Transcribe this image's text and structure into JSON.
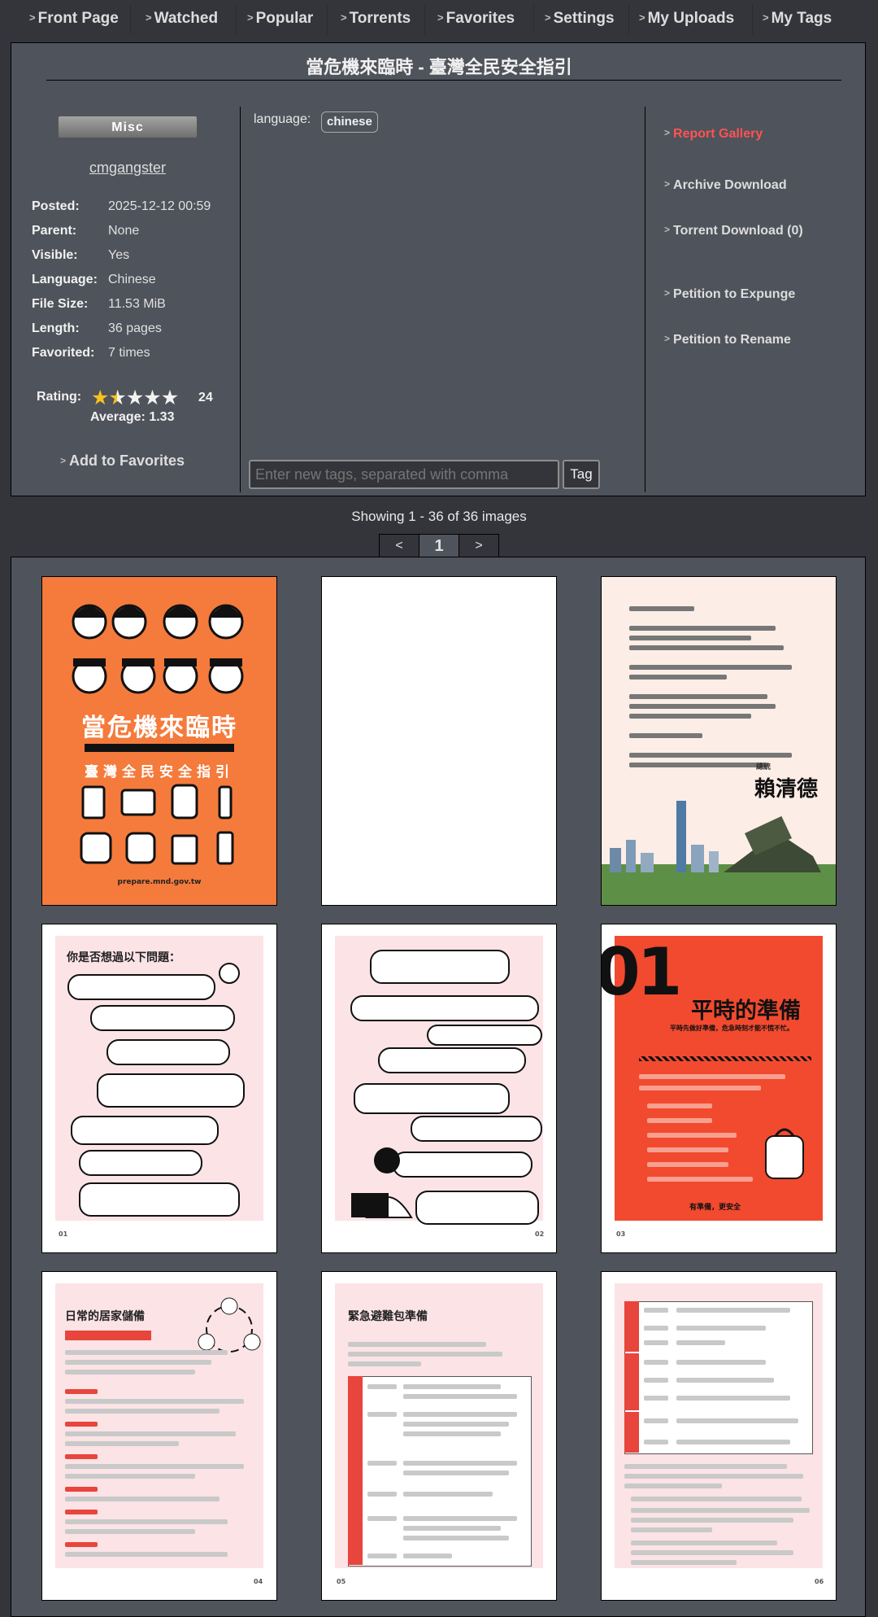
{
  "nav": [
    {
      "label": "Front Page"
    },
    {
      "label": "Watched"
    },
    {
      "label": "Popular"
    },
    {
      "label": "Torrents"
    },
    {
      "label": "Favorites"
    },
    {
      "label": "Settings"
    },
    {
      "label": "My Uploads"
    },
    {
      "label": "My Tags"
    }
  ],
  "gallery": {
    "title": "當危機來臨時 - 臺灣全民安全指引",
    "category": "Misc",
    "uploader": "cmgangster",
    "meta": [
      {
        "key": "Posted:",
        "value": "2025-12-12 00:59"
      },
      {
        "key": "Parent:",
        "value": "None"
      },
      {
        "key": "Visible:",
        "value": "Yes"
      },
      {
        "key": "Language:",
        "value": "Chinese"
      },
      {
        "key": "File Size:",
        "value": "11.53 MiB"
      },
      {
        "key": "Length:",
        "value": "36 pages"
      },
      {
        "key": "Favorited:",
        "value": "7 times"
      }
    ],
    "rating": {
      "label": "Rating:",
      "count": "24",
      "average": "Average: 1.33",
      "stars_value": 1.5,
      "stars_max": 5
    },
    "add_favorites": "Add to Favorites",
    "tags": {
      "namespace": "language:",
      "items": [
        "chinese"
      ]
    },
    "tag_input_placeholder": "Enter new tags, separated with comma",
    "tag_button": "Tag",
    "side_links": [
      "Report Gallery",
      "Archive Download",
      "Torrent Download (0)",
      "Petition to Expunge",
      "Petition to Rename"
    ],
    "accent_color": "#ff5252",
    "star_color": "#f6c21d"
  },
  "pagination": {
    "showing": "Showing 1 - 36 of 36 images",
    "prev": "<",
    "current": "1",
    "next": ">"
  },
  "thumbnails": {
    "cover": {
      "title": "當危機來臨時",
      "subtitle": "臺灣全民安全指引",
      "url": "prepare.mnd.gov.tw",
      "background": "#f47b3c"
    },
    "page3": {
      "signature": "賴清德",
      "label": "總統"
    },
    "page4": {
      "title": "你是否想過以下問題：",
      "page_no": "01"
    },
    "page5": {
      "page_no": "02"
    },
    "page6": {
      "number": "01",
      "title": "平時的準備",
      "subtitle": "平時先做好準備，危急時刻才能不慌不忙。",
      "footer": "有準備，更安全",
      "page_no": "03",
      "background": "#f24a2f"
    },
    "page7": {
      "title": "日常的居家儲備",
      "page_no": "04"
    },
    "page8": {
      "title": "緊急避難包準備",
      "page_no": "05"
    },
    "page9": {
      "page_no": "06"
    }
  }
}
